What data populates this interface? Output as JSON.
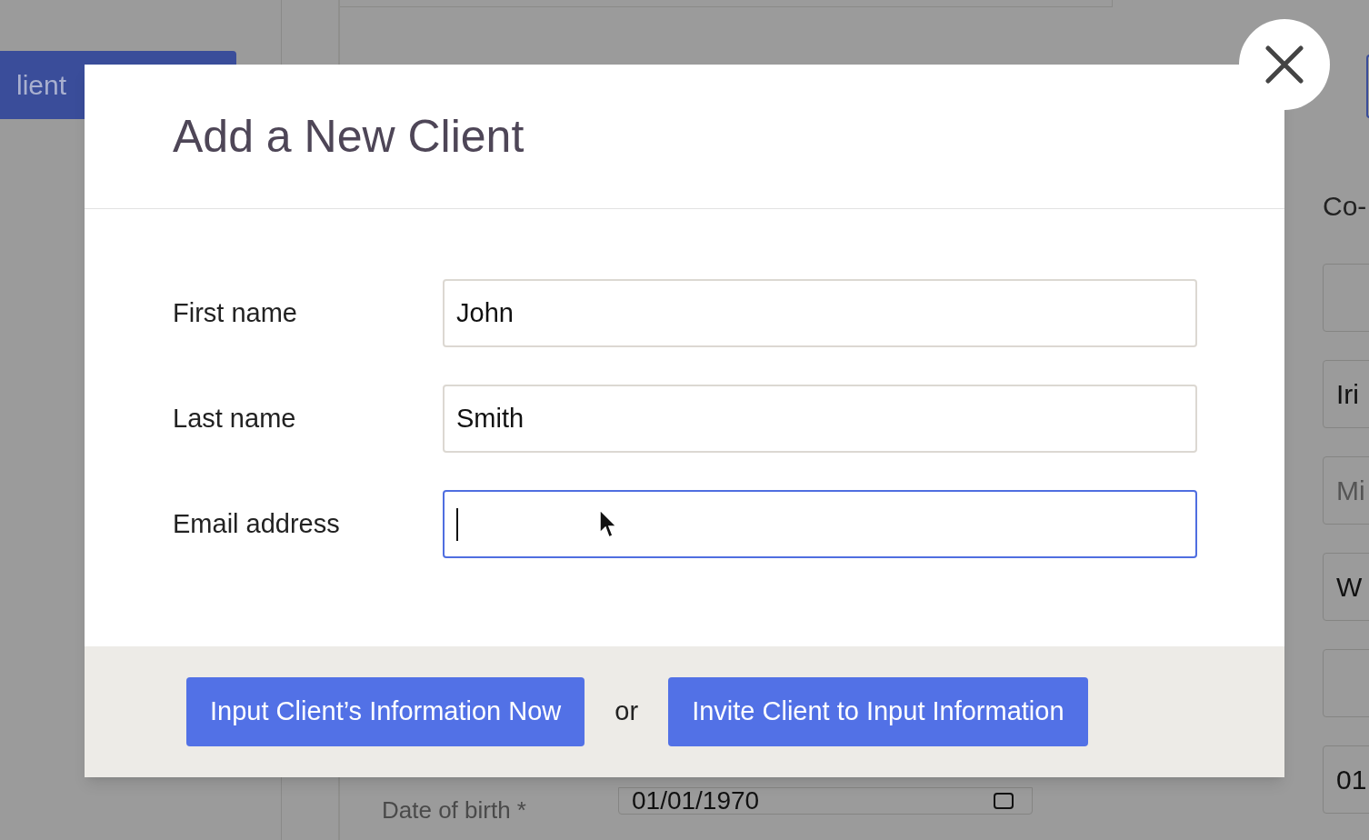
{
  "background": {
    "button": "lient",
    "heading": "Co-",
    "fields": [
      {
        "kind": "empty"
      },
      {
        "kind": "filled",
        "value": "Iri"
      },
      {
        "kind": "hint",
        "placeholder": "Mi"
      },
      {
        "kind": "filled",
        "value": "W"
      },
      {
        "kind": "empty"
      },
      {
        "kind": "filled",
        "value": "01"
      }
    ],
    "date_label": "Date of birth *",
    "date_value": "01/01/1970"
  },
  "dialog": {
    "title": "Add a New Client",
    "fields": [
      {
        "label": "First name",
        "value": "John",
        "focused": false
      },
      {
        "label": "Last name",
        "value": "Smith",
        "focused": false
      },
      {
        "label": "Email address",
        "focused": true
      }
    ],
    "actions": [
      {
        "label": "Input Client’s Information Now"
      },
      {
        "label": "Invite Client to Input Information"
      }
    ],
    "separator": "or"
  }
}
